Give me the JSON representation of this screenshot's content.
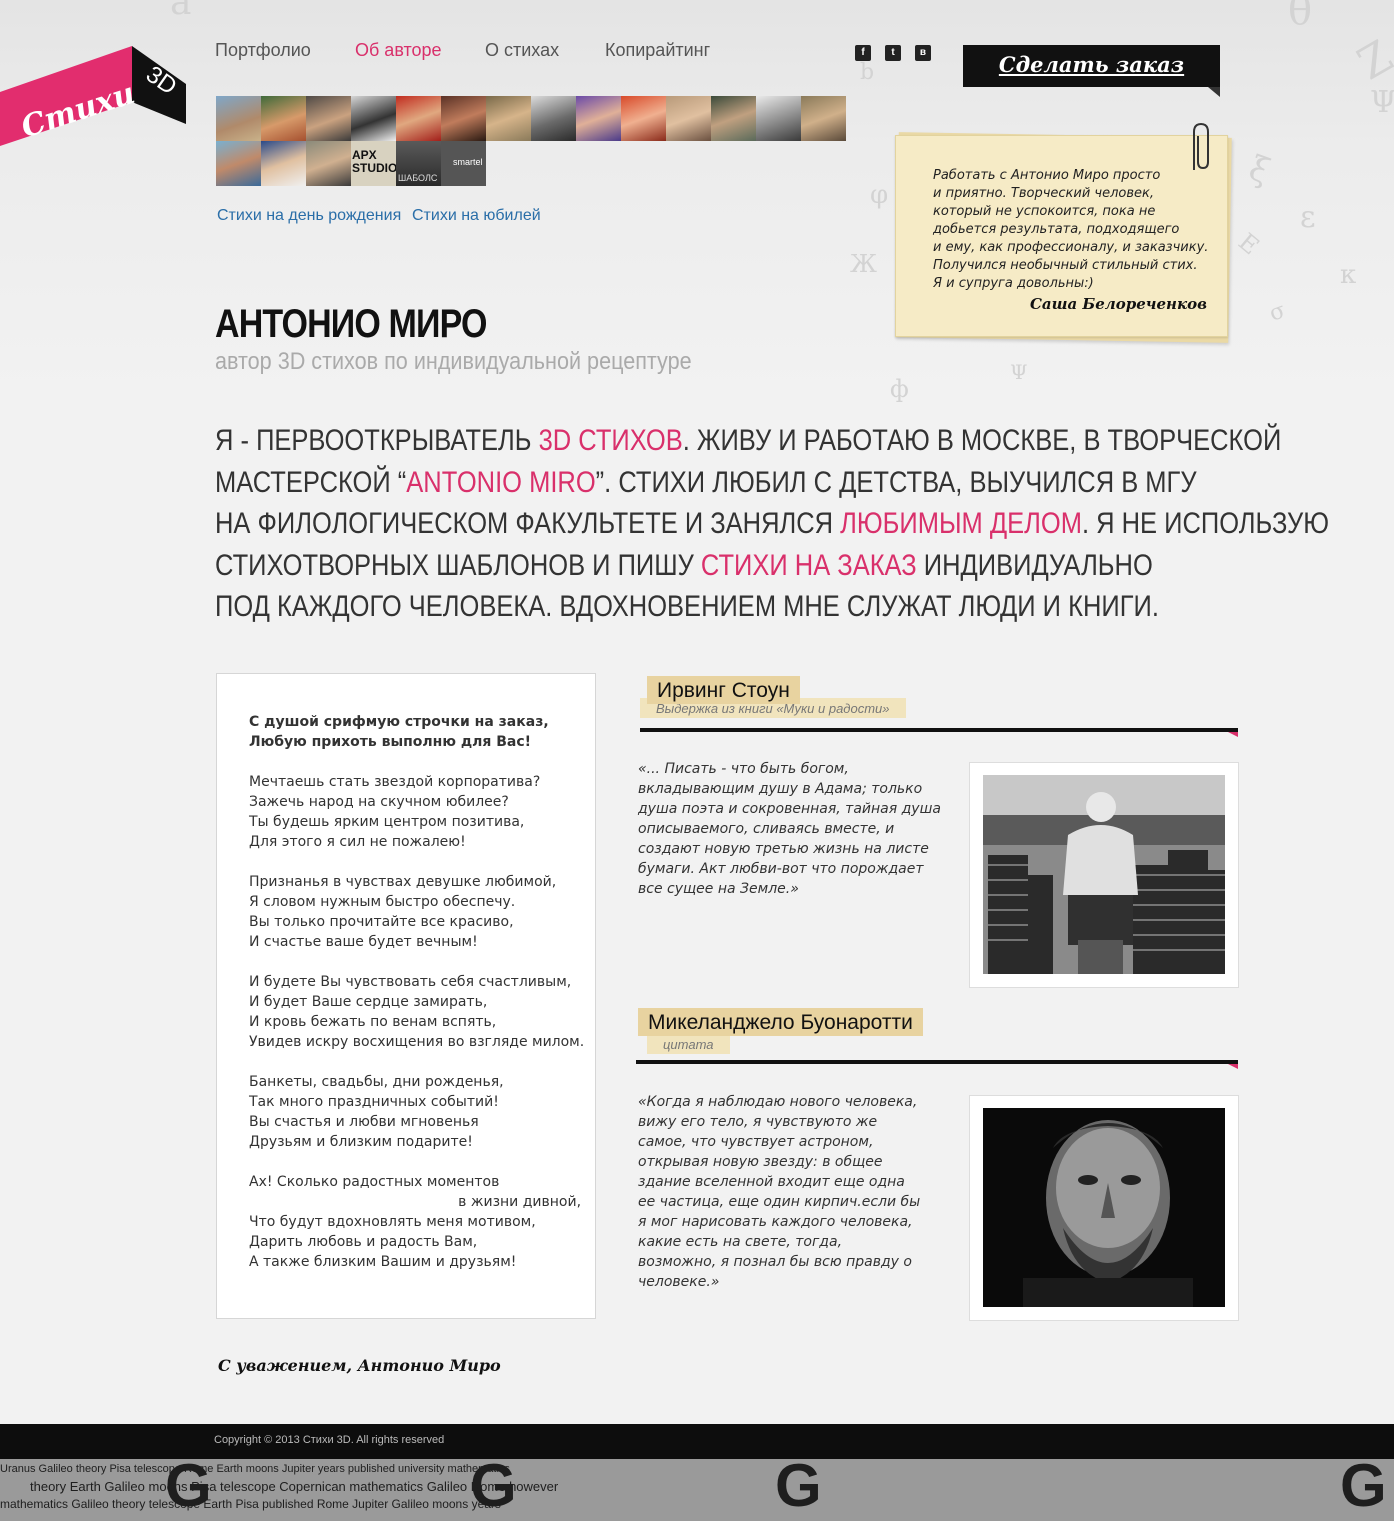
{
  "logo": {
    "script_text": "Стихи",
    "badge_text": "3D"
  },
  "nav": {
    "items": [
      {
        "label": "Портфолио"
      },
      {
        "label": "Об авторе"
      },
      {
        "label": "О стихах"
      },
      {
        "label": "Копирайтинг"
      }
    ],
    "active": "Об авторе"
  },
  "social": [
    {
      "icon": "facebook-icon",
      "glyph": "f"
    },
    {
      "icon": "twitter-icon",
      "glyph": "t"
    },
    {
      "icon": "vkontakte-icon",
      "glyph": "в"
    }
  ],
  "order_button": {
    "label": "Сделать заказ"
  },
  "mosaic": {
    "tile_labels": [
      "APX STUDIO",
      "ШАБОЛС",
      "smartel"
    ]
  },
  "sublinks": [
    {
      "label": "Стихи на день рождения"
    },
    {
      "label": "Стихи на юбилей"
    }
  ],
  "testimonial": {
    "text": "Работать с Антонио Миро просто\nи приятно. Творческий человек,\nкоторый не успокоится, пока не\nдобьется результата, подходящего\nи ему, как профессионалу, и заказчику.\nПолучился необычный стильный стих.\nЯ и супруга довольны:)",
    "author": "Саша Белореченков"
  },
  "header": {
    "name": "АНТОНИО МИРО",
    "subtitle": "автор 3D стихов по индивидуальной рецептуре"
  },
  "intro": {
    "p1": "Я - первооткрыватель ",
    "h1": "3D стихов",
    "p2": ". Живу и работаю в Москве, в творческой",
    "p3": "мастерской “",
    "h2": "Antonio Miro",
    "p4": "”. Стихи любил с детства, выучился в МГУ",
    "p5": "на филологическом факультете и занялся ",
    "h3": "любимым делом",
    "p6": ".  Я не использую",
    "p7": "стихотворных шаблонов и пишу ",
    "h4": "стихи на заказ",
    "p8": " индивидуально",
    "p9": "под каждого человека. Вдохновением мне служат люди и книги."
  },
  "poem": {
    "heading": "С душой срифмую строчки на заказ,\nЛюбую прихоть выполню для Вас!",
    "body": "Мечтаешь стать звездой корпоратива?\nЗажечь народ на скучном юбилее?\nТы будешь ярким центром позитива,\nДля этого я сил не пожалею!\n\nПризнанья в чувствах девушке любимой,\nЯ словом нужным быстро обеспечу.\nВы только прочитайте все красиво,\nИ счастье ваше будет вечным!\n\nИ будете Вы чувствовать себя счастливым,\nИ будет Ваше сердце замирать,\nИ кровь бежать по венам вспять,\nУвидев искру восхищения во взгляде милом.\n\nБанкеты, свадьбы, дни рожденья,\nТак много праздничных событий!\nВы счастья и любви мгновенья\nДрузьям и близким подарите!\n\nАх! Сколько радостных моментов\n                                               в жизни дивной,\nЧто будут вдохновлять меня мотивом,\nДарить любовь и радость Вам,\nА также близким Вашим и друзьям!"
  },
  "quotes": [
    {
      "author": "Ирвинг Стоун",
      "source": "Выдержка из книги «Муки и радости»",
      "text": "«... Писать - что быть богом,\nвкладывающим душу в Адама; только\nдуша поэта и сокровенная, тайная душа\nописываемого, сливаясь вместе, и\nсоздают новую третью жизнь на листе\nбумаги. Акт любви-вот что порождает\nвсе сущее на Земле.»"
    },
    {
      "author": "Микеланджело Буонаротти",
      "source": "цитата",
      "text": "«Когда я наблюдаю нового человека,\nвижу его тело, я чувствуюто же\nсамое, что чувствует астроном,\nоткрывая новую звезду: в общее\nздание вселенной входит еще одна\nее частица, еще один кирпич.если бы\nя мог нарисовать каждого человека,\nкакие есть на свете, тогда,\nвозможно, я познал бы всю правду о\nчеловеке.»"
    }
  ],
  "signoff": "С уважением, Антонио Миро",
  "footer": {
    "copyright": "Copyright © 2013 Стихи 3D. All rights reserved"
  },
  "colors": {
    "accent": "#d9306b",
    "link": "#2a6ea8",
    "note": "#f6ebc6",
    "tape": "#e8d3a0",
    "footer": "#0d0d0d"
  }
}
